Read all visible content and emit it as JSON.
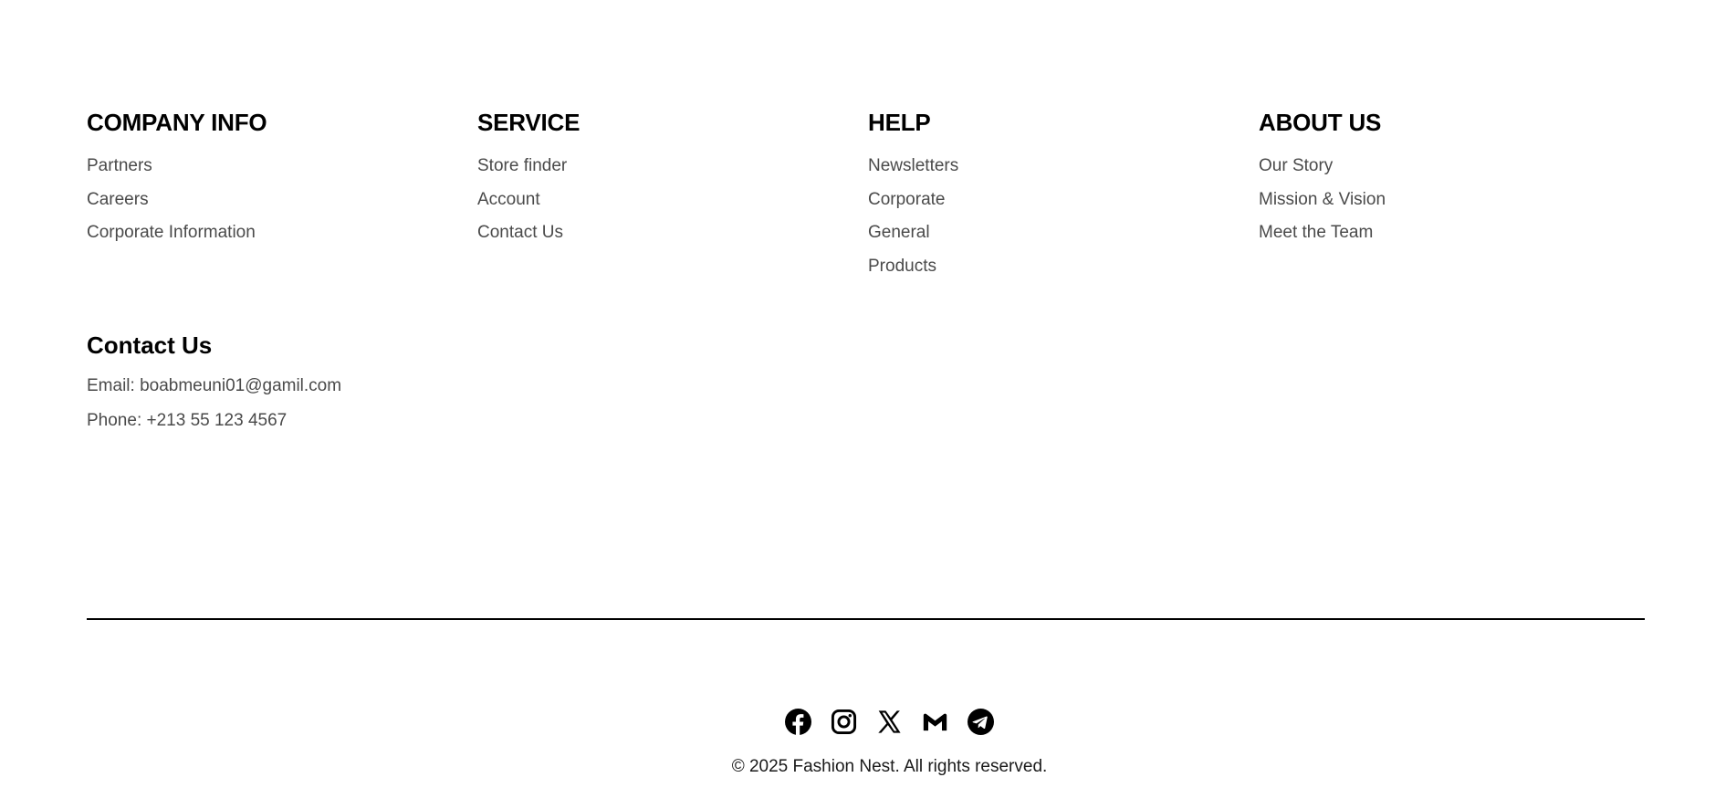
{
  "columns": [
    {
      "heading": "COMPANY INFO",
      "links": [
        "Partners",
        "Careers",
        "Corporate Information"
      ]
    },
    {
      "heading": "SERVICE",
      "links": [
        "Store finder",
        "Account",
        "Contact Us"
      ]
    },
    {
      "heading": "HELP",
      "links": [
        "Newsletters",
        "Corporate",
        "General",
        "Products"
      ]
    },
    {
      "heading": "ABOUT US",
      "links": [
        "Our Story",
        "Mission & Vision",
        "Meet the Team"
      ]
    }
  ],
  "contact": {
    "heading": "Contact Us",
    "email": "Email: boabmeuni01@gamil.com",
    "phone": "Phone: +213 55 123 4567"
  },
  "social": {
    "icons": [
      "facebook-icon",
      "instagram-icon",
      "x-icon",
      "gmail-icon",
      "telegram-icon"
    ]
  },
  "copyright": "© 2025 Fashion Nest. All rights reserved.",
  "colors": {
    "heading": "#000000",
    "link": "#4a4a4a",
    "divider": "#000000",
    "background": "#ffffff"
  }
}
